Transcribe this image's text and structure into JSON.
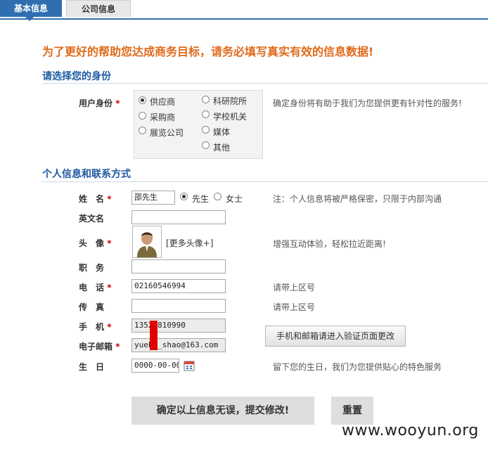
{
  "tabs": [
    {
      "label": "基本信息",
      "active": true
    },
    {
      "label": "公司信息",
      "active": false
    }
  ],
  "headline": "为了更好的帮助您达成商务目标，请务必填写真实有效的信息数据!",
  "identity_section": {
    "title": "请选择您的身份",
    "label": "用户身份",
    "required": "*",
    "options": [
      {
        "label": "供应商",
        "selected": true
      },
      {
        "label": "科研院所",
        "selected": false
      },
      {
        "label": "采购商",
        "selected": false
      },
      {
        "label": "学校机关",
        "selected": false
      },
      {
        "label": "展览公司",
        "selected": false
      },
      {
        "label": "媒体",
        "selected": false
      },
      {
        "label": "其他",
        "selected": false
      }
    ],
    "hint": "确定身份将有助于我们为您提供更有针对性的服务!"
  },
  "personal_section": {
    "title": "个人信息和联系方式",
    "name": {
      "label": "姓　名",
      "required": "*",
      "value": "邵先生",
      "gender_male": "先生",
      "gender_female": "女士",
      "gender_selected": "male",
      "hint": "注：个人信息将被严格保密，只限于内部沟通"
    },
    "english_name": {
      "label": "英文名",
      "value": ""
    },
    "avatar": {
      "label": "头　像",
      "required": "*",
      "more_link": "[更多头像+]",
      "hint": "增强互动体验，轻松拉近距离!"
    },
    "position": {
      "label": "职　务",
      "value": ""
    },
    "phone": {
      "label": "电　话",
      "required": "*",
      "value": "02160546994",
      "hint": "请带上区号"
    },
    "fax": {
      "label": "传　真",
      "value": "",
      "hint": "请带上区号"
    },
    "mobile": {
      "label": "手　机",
      "required": "*",
      "value": "1352  810990"
    },
    "email": {
      "label": "电子邮箱",
      "required": "*",
      "value": "yueb   _shao@163.com"
    },
    "verify_button": "手机和邮箱请进入验证页面更改",
    "birthday": {
      "label": "生　日",
      "value": "0000-00-00",
      "hint": "留下您的生日，我们为您提供贴心的特色服务"
    }
  },
  "actions": {
    "submit": "确定以上信息无误，提交修改!",
    "reset": "重置"
  },
  "watermark": "www.wooyun.org",
  "colors": {
    "accent": "#2f6fb0",
    "headline": "#e06a1a",
    "section": "#1d5aa0",
    "required": "#cc0000",
    "redaction": "#e00000"
  }
}
